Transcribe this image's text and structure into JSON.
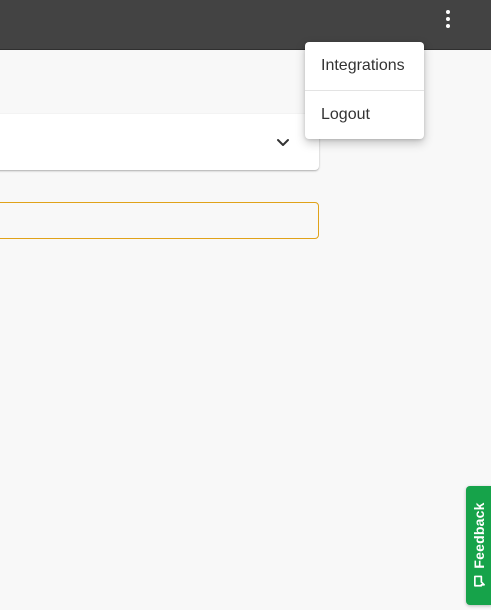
{
  "header": {
    "menu_icon": "more-vert-icon"
  },
  "form": {
    "select": {
      "value": "",
      "icon": "chevron-down-icon"
    },
    "text_input": {
      "value": "",
      "placeholder": ""
    }
  },
  "overflow_menu": {
    "items": [
      {
        "label": "Integrations"
      },
      {
        "label": "Logout"
      }
    ]
  },
  "feedback_tab": {
    "label": "Feedback",
    "icon": "feedback-icon"
  },
  "colors": {
    "topbar": "#434343",
    "page_background": "#f8f8f8",
    "input_focus_border": "#e0a21a",
    "feedback_green": "#16a34a"
  }
}
